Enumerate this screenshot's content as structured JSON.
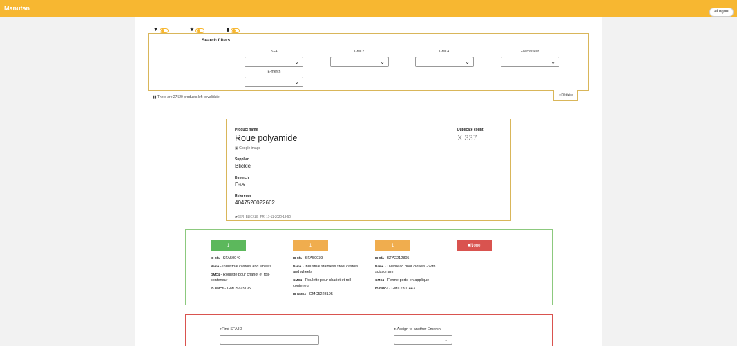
{
  "app": {
    "brand": "Manutan",
    "logout_label": "Logout"
  },
  "toggles": [
    {
      "icon": "filter-icon",
      "glyph": "▼"
    },
    {
      "icon": "gear-icon",
      "glyph": "✱"
    },
    {
      "icon": "file-icon",
      "glyph": "▮"
    }
  ],
  "filters": {
    "title": "Search filters",
    "labels": {
      "sfa": "SFA",
      "gmc2": "GMC2",
      "gmc4": "GMC4",
      "supplier": "Fournisseur",
      "emerch": "E-merch"
    },
    "reduce_label": "Réduire",
    "remaining": "There are 27520 products left to validate"
  },
  "product": {
    "name_label": "Product name",
    "name": "Roue polyamide",
    "google_label": "Google image",
    "duplicate_label": "Duplicate count",
    "duplicate_value": "X 337",
    "supplier_label": "Supplier",
    "supplier": "Blickle",
    "emerch_label": "E-merch",
    "emerch": "Dsa",
    "reference_label": "Reference",
    "reference": "4047526022662",
    "folder": "GER_BLICKLE_FR_17-11-2020-19-50"
  },
  "suggestions": [
    {
      "button": "1",
      "color": "#5cb85c",
      "id_sfa": "SFA50040",
      "name": "Industrial castors and wheels",
      "gmc4": "Roulette pour chariot et roll-conteneur",
      "id_gmc4": "GMC5223195"
    },
    {
      "button": "1",
      "color": "#f0ad4e",
      "id_sfa": "SFA50039",
      "name": "Industrial stainless steel castors and wheels",
      "gmc4": "Roulette pour chariot et roll-conteneur",
      "id_gmc4": "GMC5223195"
    },
    {
      "button": "1",
      "color": "#f0ad4e",
      "id_sfa": "SFA2212805",
      "name": "Overhead door closers - with scissor arm",
      "gmc4": "Ferme-porte en applique",
      "id_gmc4": "GMC2301443"
    }
  ],
  "suggest_labels": {
    "id_sfa": "ID Sfa",
    "name": "Name",
    "gmc4": "GMC4",
    "id_gmc4": "ID GMC4",
    "none": "None"
  },
  "actions": {
    "find_label": "Find SFA ID",
    "assign_label": "Assign to another Emerch"
  }
}
